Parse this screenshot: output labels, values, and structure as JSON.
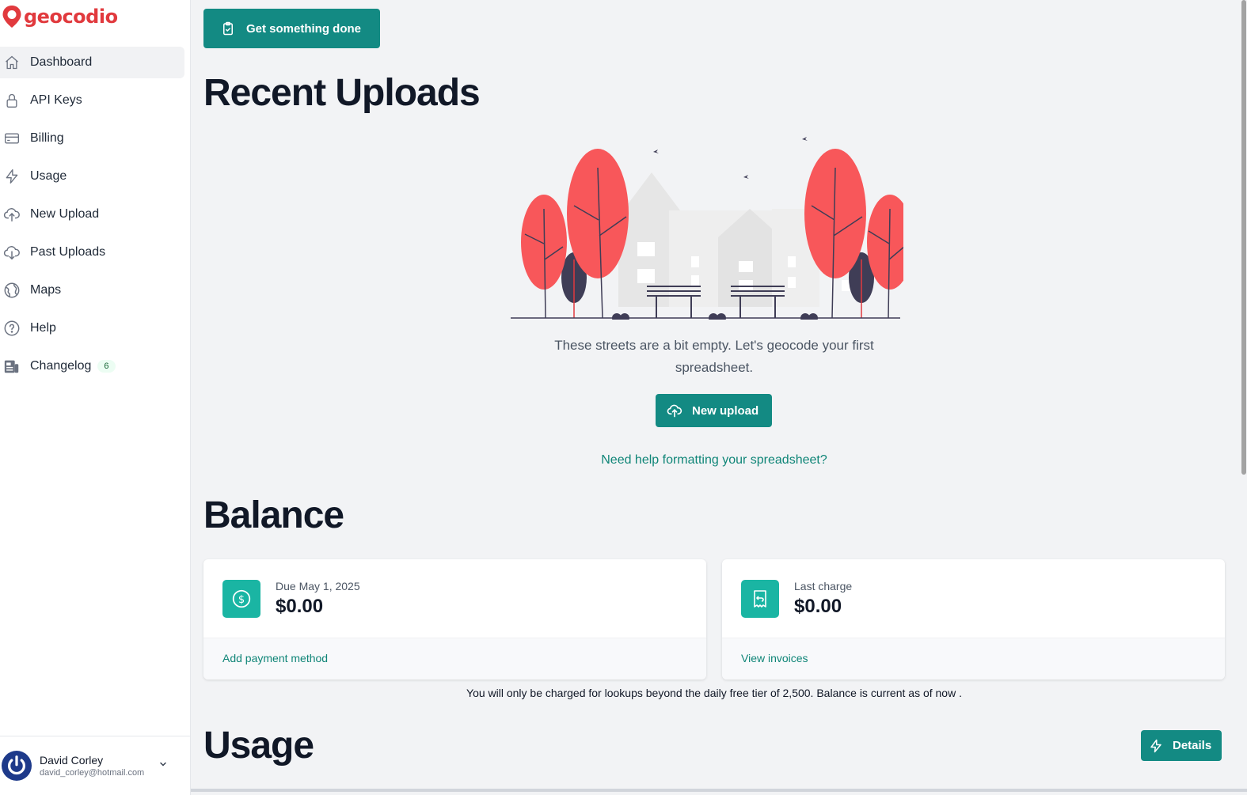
{
  "app": {
    "logo_text": "geocodio",
    "brand_color": "#e13a3e",
    "accent_color": "#138a83"
  },
  "sidebar": {
    "items": [
      {
        "label": "Dashboard",
        "icon": "home-icon",
        "active": true
      },
      {
        "label": "API Keys",
        "icon": "lock-icon"
      },
      {
        "label": "Billing",
        "icon": "credit-card-icon"
      },
      {
        "label": "Usage",
        "icon": "lightning-icon"
      },
      {
        "label": "New Upload",
        "icon": "cloud-upload-icon"
      },
      {
        "label": "Past Uploads",
        "icon": "cloud-download-icon"
      },
      {
        "label": "Maps",
        "icon": "globe-icon"
      },
      {
        "label": "Help",
        "icon": "question-circle-icon"
      },
      {
        "label": "Changelog",
        "icon": "newspaper-icon",
        "badge": "6"
      }
    ]
  },
  "user": {
    "name": "David Corley",
    "email": "david_corley@hotmail.com"
  },
  "main": {
    "top_button": "Get something done",
    "recent_uploads": {
      "title": "Recent Uploads",
      "empty_text": "These streets are a bit empty. Let's geocode your first spreadsheet.",
      "new_upload_label": "New upload",
      "help_link": "Need help formatting your spreadsheet?"
    },
    "balance": {
      "title": "Balance",
      "due_card": {
        "label": "Due May 1, 2025",
        "value": "$0.00",
        "link": "Add payment method",
        "icon": "dollar-circle-icon"
      },
      "charge_card": {
        "label": "Last charge",
        "value": "$0.00",
        "link": "View invoices",
        "icon": "receipt-icon"
      },
      "note": "You will only be charged for lookups beyond the daily free tier of 2,500. Balance is current as of now ."
    },
    "usage": {
      "title": "Usage",
      "details_label": "Details"
    }
  }
}
